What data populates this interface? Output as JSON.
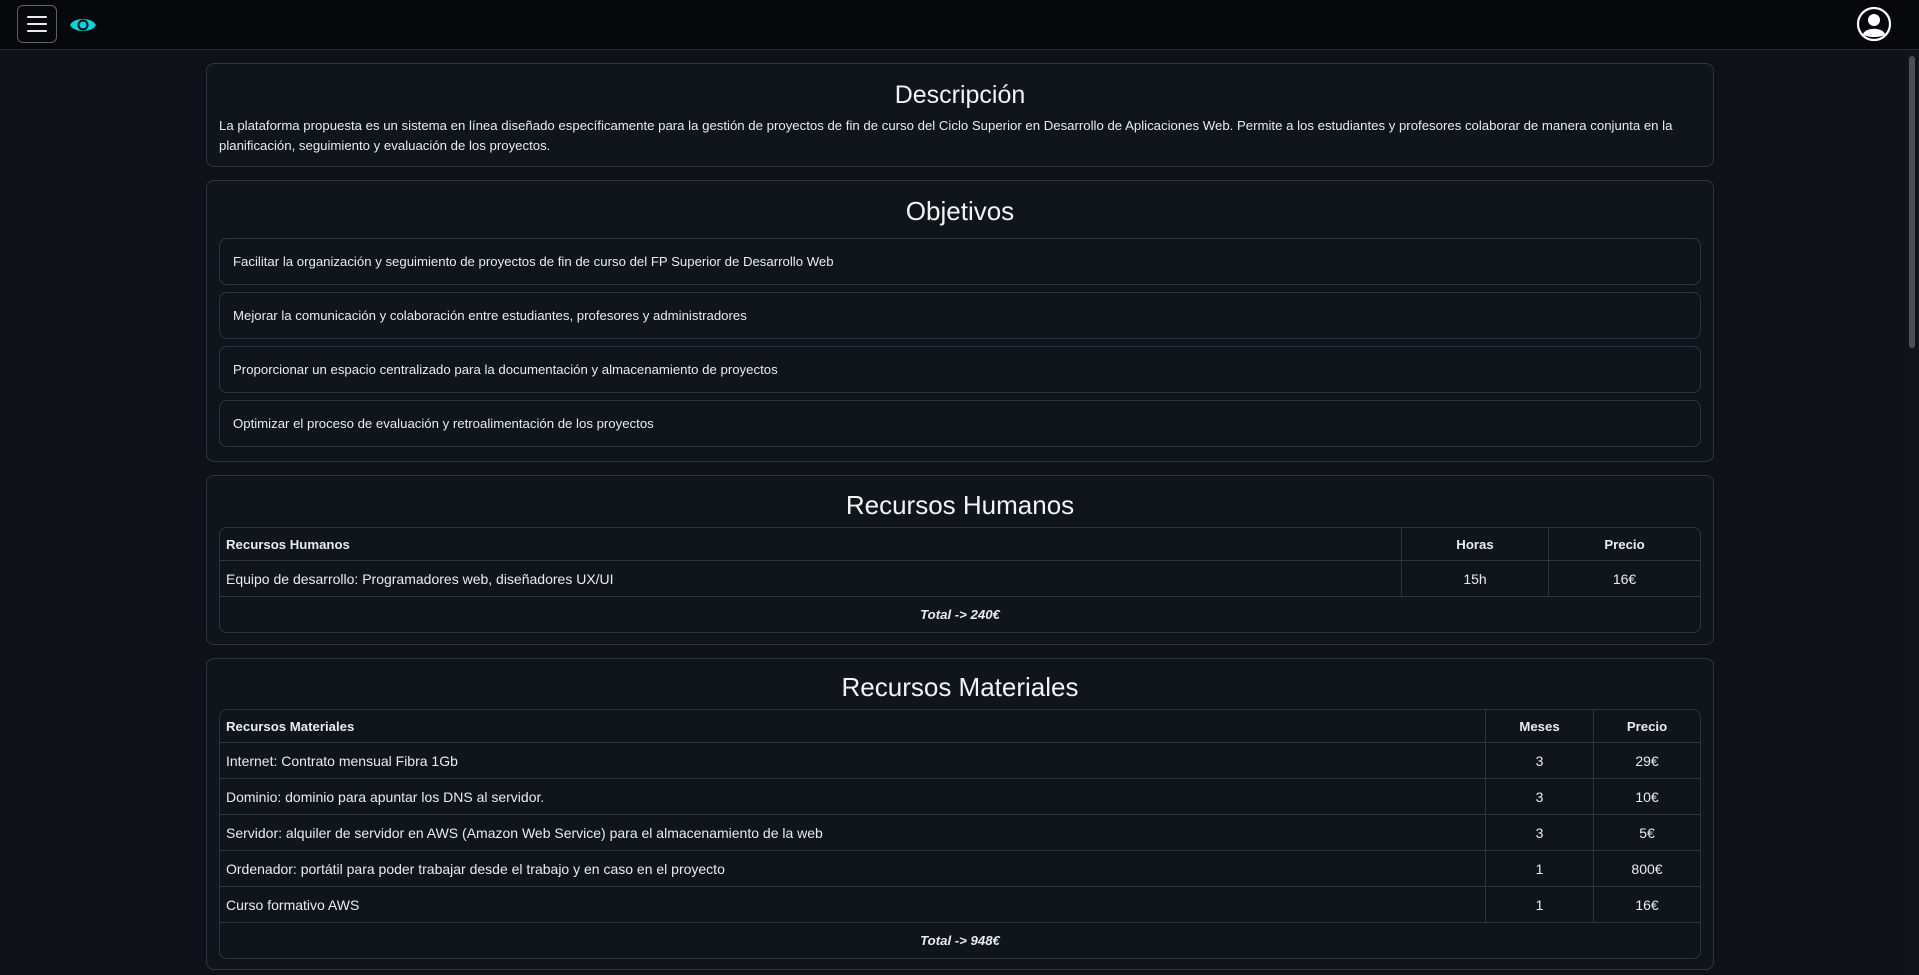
{
  "nav": {
    "menu_icon": "hamburger-menu-icon",
    "logo_icon": "eye-icon",
    "user_icon": "user-circle-icon",
    "accent": "#00d8e0"
  },
  "descripcion": {
    "title": "Descripción",
    "text": "La plataforma propuesta es un sistema en línea diseñado específicamente para la gestión de proyectos de fin de curso del Ciclo Superior en Desarrollo de Aplicaciones Web. Permite a los estudiantes y profesores colaborar de manera conjunta en la planificación, seguimiento y evaluación de los proyectos."
  },
  "objetivos": {
    "title": "Objetivos",
    "items": [
      "Facilitar la organización y seguimiento de proyectos de fin de curso del FP Superior de Desarrollo Web",
      "Mejorar la comunicación y colaboración entre estudiantes, profesores y administradores",
      "Proporcionar un espacio centralizado para la documentación y almacenamiento de proyectos",
      "Optimizar el proceso de evaluación y retroalimentación de los proyectos"
    ]
  },
  "recursos_humanos": {
    "title": "Recursos Humanos",
    "headers": [
      "Recursos Humanos",
      "Horas",
      "Precio"
    ],
    "rows": [
      [
        "Equipo de desarrollo: Programadores web, diseñadores UX/UI",
        "15h",
        "16€"
      ]
    ],
    "total": "Total -> 240€"
  },
  "recursos_materiales": {
    "title": "Recursos Materiales",
    "headers": [
      "Recursos Materiales",
      "Meses",
      "Precio"
    ],
    "rows": [
      [
        "Internet: Contrato mensual Fibra 1Gb",
        "3",
        "29€"
      ],
      [
        "Dominio: dominio para apuntar los DNS al servidor.",
        "3",
        "10€"
      ],
      [
        "Servidor: alquiler de servidor en AWS (Amazon Web Service) para el almacenamiento de la web",
        "3",
        "5€"
      ],
      [
        "Ordenador: portátil para poder trabajar desde el trabajo y en caso en el proyecto",
        "1",
        "800€"
      ],
      [
        "Curso formativo AWS",
        "1",
        "16€"
      ]
    ],
    "total": "Total -> 948€"
  }
}
